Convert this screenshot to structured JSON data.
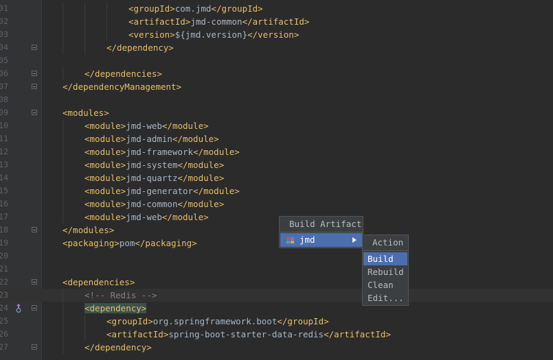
{
  "editor": {
    "lines": [
      {
        "num": "01",
        "indent": 3,
        "parts": [
          [
            "t",
            "<groupId>"
          ],
          [
            "x",
            "com.jmd"
          ],
          [
            "t",
            "</groupId>"
          ]
        ]
      },
      {
        "num": "02",
        "indent": 3,
        "parts": [
          [
            "t",
            "<artifactId>"
          ],
          [
            "x",
            "jmd-common"
          ],
          [
            "t",
            "</artifactId>"
          ]
        ]
      },
      {
        "num": "03",
        "indent": 3,
        "parts": [
          [
            "t",
            "<version>"
          ],
          [
            "x",
            "${jmd.version}"
          ],
          [
            "t",
            "</version>"
          ]
        ]
      },
      {
        "num": "04",
        "indent": 2,
        "fold": true,
        "parts": [
          [
            "t",
            "</dependency>"
          ]
        ]
      },
      {
        "num": "05",
        "indent": 0,
        "parts": []
      },
      {
        "num": "06",
        "indent": 1,
        "fold": true,
        "parts": [
          [
            "t",
            "</dependencies>"
          ]
        ]
      },
      {
        "num": "07",
        "indent": 0,
        "fold": true,
        "parts": [
          [
            "t",
            "</dependencyManagement>"
          ]
        ]
      },
      {
        "num": "08",
        "indent": 0,
        "parts": []
      },
      {
        "num": "09",
        "indent": 0,
        "fold": true,
        "parts": [
          [
            "t",
            "<modules>"
          ]
        ]
      },
      {
        "num": "10",
        "indent": 1,
        "parts": [
          [
            "t",
            "<module>"
          ],
          [
            "x",
            "jmd-web"
          ],
          [
            "t",
            "</module>"
          ]
        ]
      },
      {
        "num": "11",
        "indent": 1,
        "parts": [
          [
            "t",
            "<module>"
          ],
          [
            "x",
            "jmd-admin"
          ],
          [
            "t",
            "</module>"
          ]
        ]
      },
      {
        "num": "12",
        "indent": 1,
        "parts": [
          [
            "t",
            "<module>"
          ],
          [
            "x",
            "jmd-framework"
          ],
          [
            "t",
            "</module>"
          ]
        ]
      },
      {
        "num": "13",
        "indent": 1,
        "parts": [
          [
            "t",
            "<module>"
          ],
          [
            "x",
            "jmd-system"
          ],
          [
            "t",
            "</module>"
          ]
        ]
      },
      {
        "num": "14",
        "indent": 1,
        "parts": [
          [
            "t",
            "<module>"
          ],
          [
            "x",
            "jmd-quartz"
          ],
          [
            "t",
            "</module>"
          ]
        ]
      },
      {
        "num": "15",
        "indent": 1,
        "parts": [
          [
            "t",
            "<module>"
          ],
          [
            "x",
            "jmd-generator"
          ],
          [
            "t",
            "</module>"
          ]
        ]
      },
      {
        "num": "16",
        "indent": 1,
        "parts": [
          [
            "t",
            "<module>"
          ],
          [
            "x",
            "jmd-common"
          ],
          [
            "t",
            "</module>"
          ]
        ]
      },
      {
        "num": "17",
        "indent": 1,
        "parts": [
          [
            "t",
            "<module>"
          ],
          [
            "x",
            "jmd-web"
          ],
          [
            "t",
            "</module>"
          ]
        ]
      },
      {
        "num": "18",
        "indent": 0,
        "fold": true,
        "parts": [
          [
            "t",
            "</modules>"
          ]
        ]
      },
      {
        "num": "19",
        "indent": 0,
        "parts": [
          [
            "t",
            "<packaging>"
          ],
          [
            "x",
            "pom"
          ],
          [
            "t",
            "</packaging>"
          ]
        ]
      },
      {
        "num": "20",
        "indent": 0,
        "parts": []
      },
      {
        "num": "21",
        "indent": 0,
        "parts": []
      },
      {
        "num": "22",
        "indent": 0,
        "fold": true,
        "parts": [
          [
            "t",
            "<dependencies>"
          ]
        ]
      },
      {
        "num": "23",
        "indent": 1,
        "highlight": true,
        "parts": [
          [
            "c",
            "<!-- Redis -->"
          ]
        ]
      },
      {
        "num": "24",
        "indent": 1,
        "fold": true,
        "bookmark": true,
        "parts": [
          [
            "tb",
            "<dependency>"
          ]
        ]
      },
      {
        "num": "25",
        "indent": 2,
        "parts": [
          [
            "t",
            "<groupId>"
          ],
          [
            "x",
            "org.springframework.boot"
          ],
          [
            "t",
            "</groupId>"
          ]
        ]
      },
      {
        "num": "26",
        "indent": 2,
        "parts": [
          [
            "t",
            "<artifactId>"
          ],
          [
            "x",
            "spring-boot-starter-data-redis"
          ],
          [
            "t",
            "</artifactId>"
          ]
        ]
      },
      {
        "num": "27",
        "indent": 1,
        "fold": true,
        "parts": [
          [
            "t",
            "</dependency>"
          ]
        ]
      }
    ]
  },
  "build_popup": {
    "title": "Build Artifact",
    "item_label": "jmd"
  },
  "action_popup": {
    "title": "Action",
    "items": [
      "Build",
      "Rebuild",
      "Clean",
      "Edit..."
    ]
  }
}
